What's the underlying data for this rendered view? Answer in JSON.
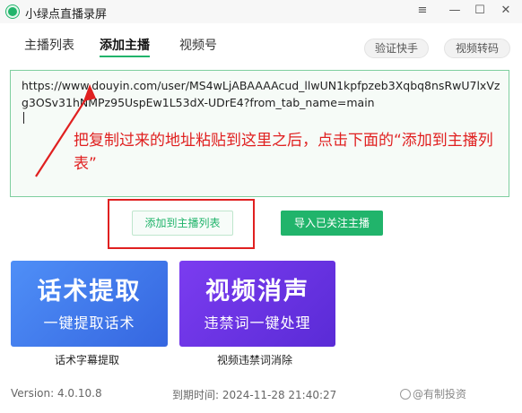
{
  "window": {
    "title": "小绿点直播录屏",
    "controls": {
      "menu": "≡",
      "minimize": "—",
      "maximize": "☐",
      "close": "✕"
    }
  },
  "tabs": [
    {
      "label": "主播列表"
    },
    {
      "label": "添加主播",
      "active": true
    },
    {
      "label": "视频号"
    }
  ],
  "toolbar": {
    "verify_label": "验证快手",
    "convert_label": "视频转码"
  },
  "url_input": {
    "value": "https://www.douyin.com/user/MS4wLjABAAAAcud_llwUN1kpfpzeb3Xqbq8nsRwU7lxVzg3OSv31hNMPz95UspEw1L53dX-UDrE4?from_tab_name=main"
  },
  "annotation": {
    "text": "把复制过来的地址粘贴到这里之后，点击下面的“添加到主播列表”"
  },
  "actions": {
    "add_label": "添加到主播列表",
    "import_label": "导入已关注主播"
  },
  "cards": [
    {
      "title": "话术提取",
      "subtitle": "一键提取话术",
      "caption": "话术字幕提取"
    },
    {
      "title": "视频消声",
      "subtitle": "违禁词一键处理",
      "caption": "视频违禁词消除"
    }
  ],
  "footer": {
    "version": "Version:  4.0.10.8",
    "expire": "到期时间:  2024-11-28 21:40:27"
  },
  "watermark": {
    "text": "@有制投资"
  },
  "colors": {
    "accent": "#21b46b",
    "annotation": "#e02020",
    "card_blue": "#3f79ec",
    "card_purple": "#6a33e3"
  }
}
